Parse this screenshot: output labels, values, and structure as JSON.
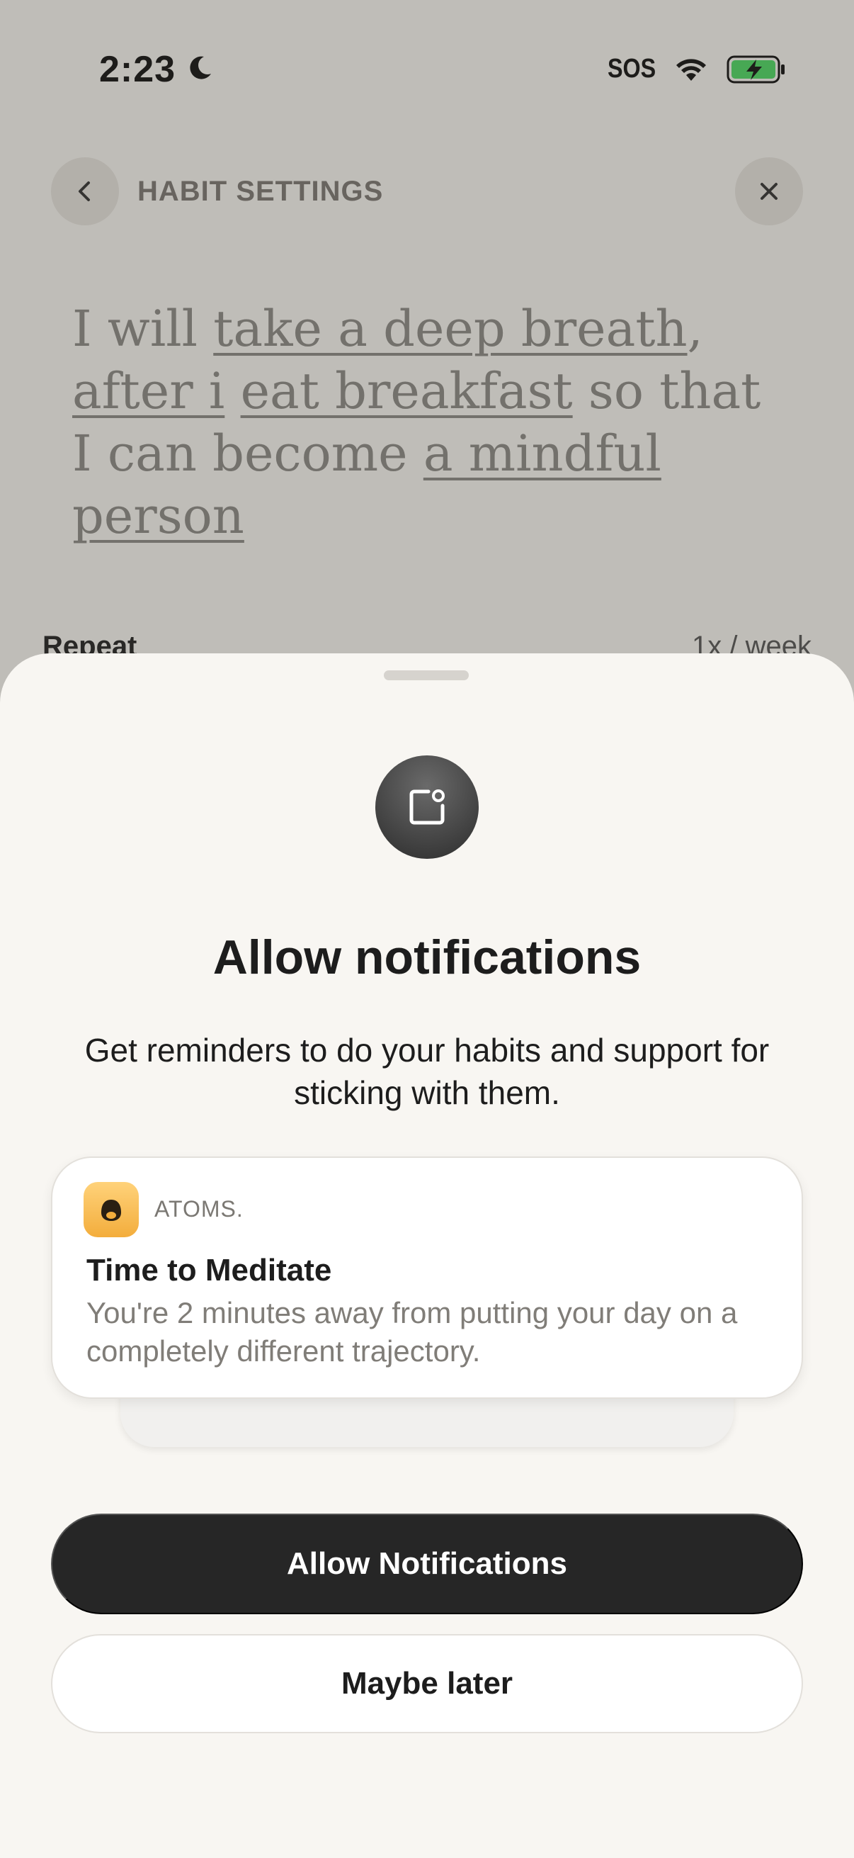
{
  "status_bar": {
    "time": "2:23",
    "carrier": "SOS",
    "moon_icon": "moon-icon",
    "wifi_icon": "wifi-icon",
    "battery_icon": "battery-charging-icon",
    "battery_color": "#4cd964"
  },
  "header": {
    "title": "HABIT SETTINGS",
    "back_icon": "chevron-left-icon",
    "close_icon": "close-icon"
  },
  "habit_sentence": {
    "p1": "I will ",
    "action": "take a deep breath",
    "p2": ", ",
    "cue_a": "after i",
    "p3": " ",
    "cue_b": "eat breakfast",
    "p4": " so that I can become ",
    "identity": "a mindful person",
    "underline_colors": [
      "#e0a357",
      "#b57fc7"
    ]
  },
  "repeat": {
    "label": "Repeat",
    "value": "1x / week"
  },
  "sheet": {
    "icon": "notification-badge-icon",
    "title": "Allow notifications",
    "description": "Get reminders to do your habits and support for sticking with them.",
    "preview": {
      "app_icon": "atoms-app-icon",
      "app_name": "ATOMS.",
      "title": "Time to Meditate",
      "body": "You're 2 minutes away from putting your day on a completely different trajectory."
    },
    "primary_button": "Allow Notifications",
    "secondary_button": "Maybe later"
  }
}
